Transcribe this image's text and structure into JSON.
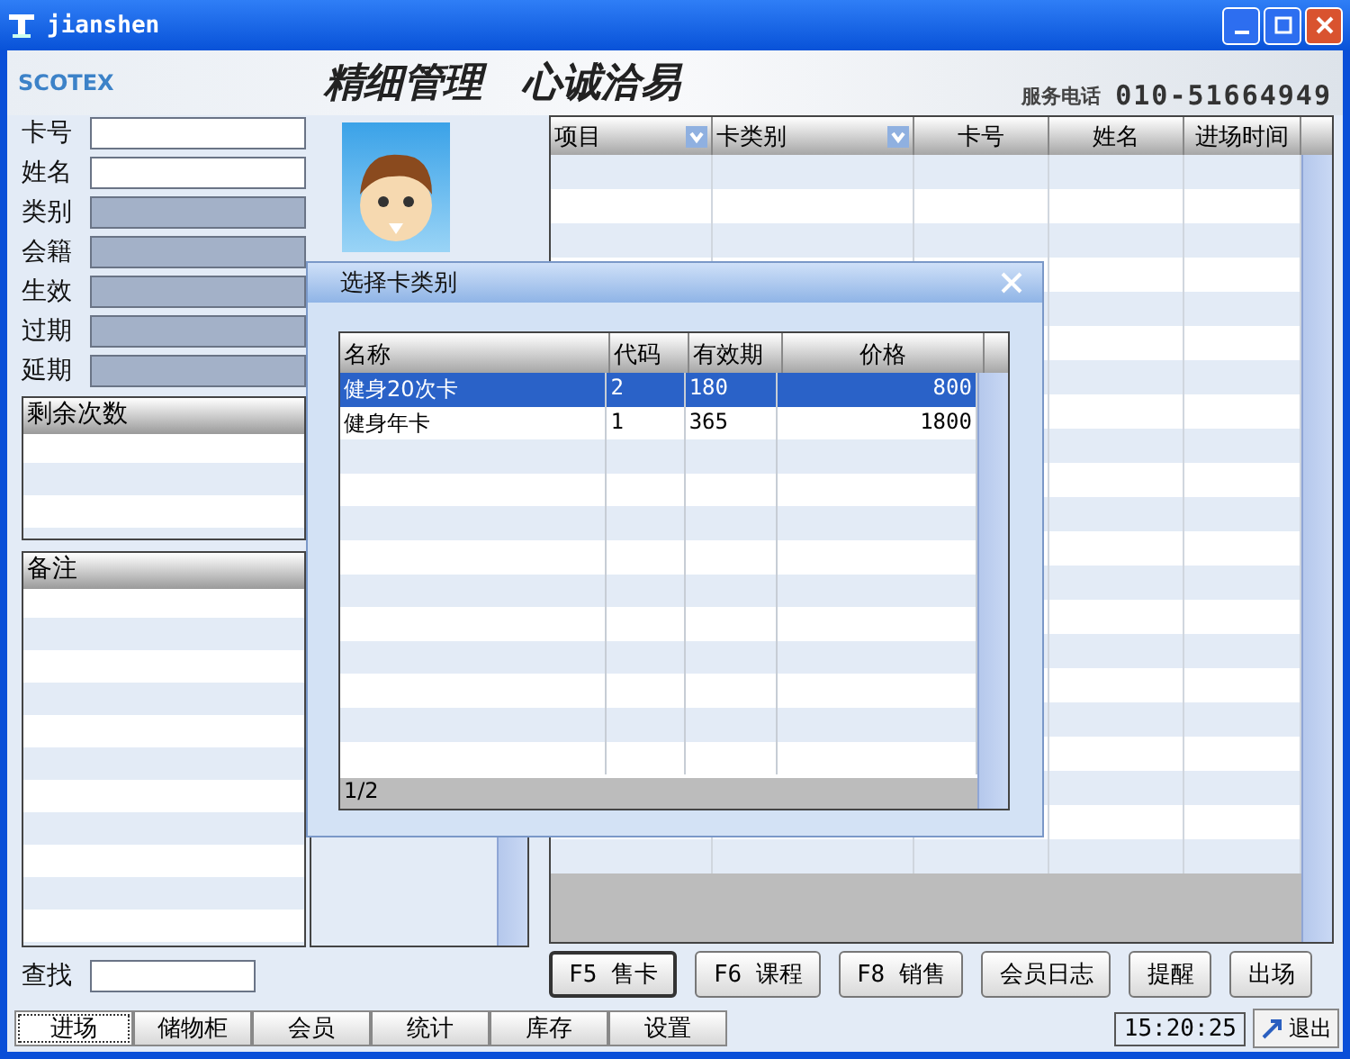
{
  "window": {
    "title": "jianshen"
  },
  "banner": {
    "logo": "SCOTEX",
    "slogan": "精细管理　心诚洽易",
    "phone_label": "服务电话",
    "phone": "010-51664949"
  },
  "member_form": {
    "fields": [
      {
        "label": "卡号",
        "editable": true
      },
      {
        "label": "姓名",
        "editable": true
      },
      {
        "label": "类别",
        "editable": false
      },
      {
        "label": "会籍",
        "editable": false
      },
      {
        "label": "生效",
        "editable": false
      },
      {
        "label": "过期",
        "editable": false
      },
      {
        "label": "延期",
        "editable": false
      }
    ]
  },
  "remaining_panel": {
    "title": "剩余次数"
  },
  "notes_panel": {
    "title": "备注"
  },
  "search": {
    "label": "查找"
  },
  "entry_table": {
    "columns": [
      {
        "label": "项目",
        "filter": true
      },
      {
        "label": "卡类别",
        "filter": true
      },
      {
        "label": "卡号",
        "filter": false
      },
      {
        "label": "姓名",
        "filter": false
      },
      {
        "label": "进场时间",
        "filter": false
      }
    ]
  },
  "actions": [
    {
      "label": "F5 售卡",
      "default": true
    },
    {
      "label": "F6 课程",
      "default": false
    },
    {
      "label": "F8 销售",
      "default": false
    },
    {
      "label": "会员日志",
      "default": false
    },
    {
      "label": "提醒",
      "default": false
    },
    {
      "label": "出场",
      "default": false
    }
  ],
  "tabs": [
    {
      "label": "进场",
      "selected": true
    },
    {
      "label": "储物柜",
      "selected": false
    },
    {
      "label": "会员",
      "selected": false
    },
    {
      "label": "统计",
      "selected": false
    },
    {
      "label": "库存",
      "selected": false
    },
    {
      "label": "设置",
      "selected": false
    }
  ],
  "clock": "15:20:25",
  "exit_button": "退出",
  "dialog": {
    "title": "选择卡类别",
    "columns": [
      {
        "label": "名称",
        "right_aligned": false
      },
      {
        "label": "代码",
        "right_aligned": false
      },
      {
        "label": "有效期",
        "right_aligned": false
      },
      {
        "label": "价格",
        "right_aligned": true
      }
    ],
    "rows": [
      {
        "cells": [
          "健身20次卡",
          "2",
          "180",
          "800"
        ],
        "selected": true
      },
      {
        "cells": [
          "健身年卡",
          "1",
          "365",
          "1800"
        ],
        "selected": false
      }
    ],
    "pager": "1/2"
  }
}
